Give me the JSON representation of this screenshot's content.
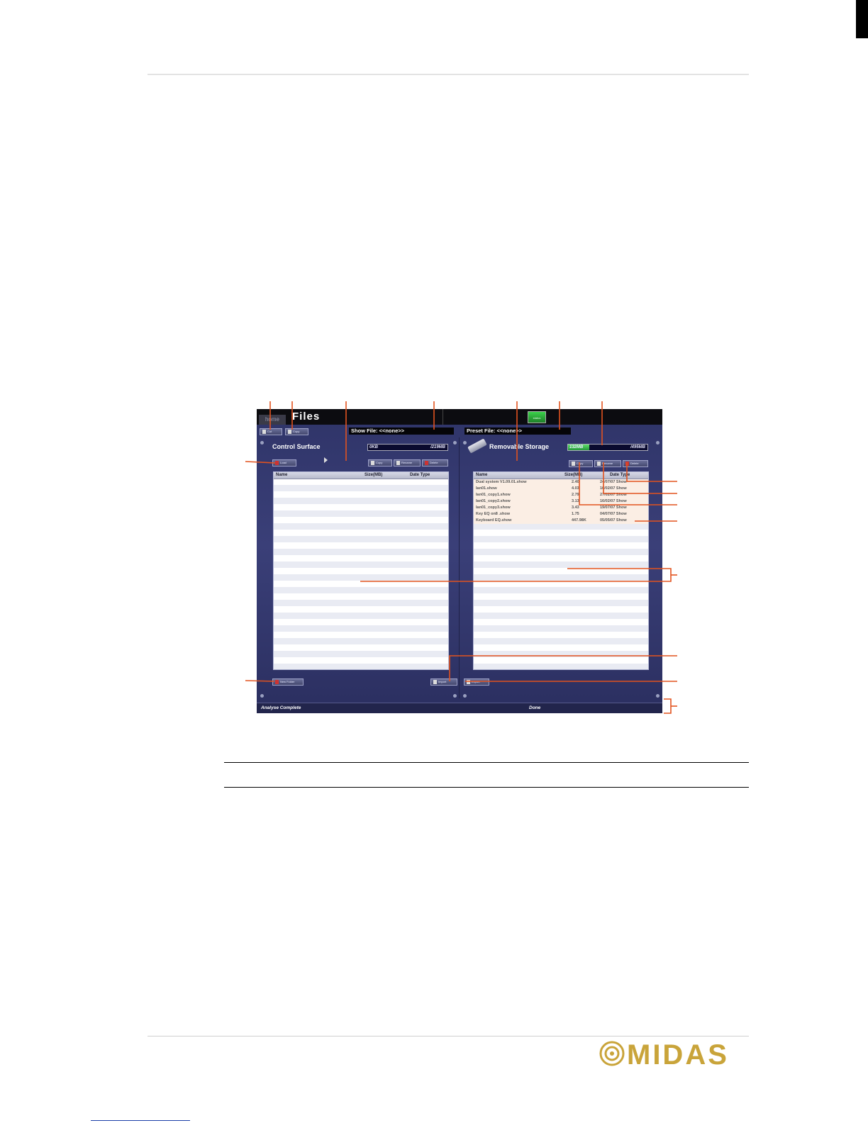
{
  "screen": {
    "home_tab": "home",
    "title": "Files",
    "status_button": "status",
    "show_file": "Show File: <<none>>",
    "preset_file": "Preset File: <<none>>",
    "toolbar": {
      "cut": "Cut",
      "copy": "Copy"
    },
    "control_surface": {
      "title": "Control Surface",
      "meter_used": "0KB",
      "meter_total": "/219MB",
      "load_button": "Load",
      "copy_button": "Copy",
      "rename_button": "Rename",
      "delete_button": "Delete",
      "columns": [
        "Name",
        "Size(MB)",
        "Date Type"
      ],
      "new_folder_button": "New Folder",
      "import_button": "Import"
    },
    "removable_storage": {
      "title": "Removable Storage",
      "meter_used": "132MB",
      "meter_total": "/495MB",
      "meter_fraction": 0.27,
      "copy_button": "Copy",
      "rename_button": "Rename",
      "delete_button": "Delete",
      "columns": [
        "Name",
        "Size(MB)",
        "Date Type"
      ],
      "files": [
        {
          "name": "Dual system V1.09.01.show",
          "size": "2.40",
          "date_type": "24/07/07 Show"
        },
        {
          "name": "Ian01.show",
          "size": "4.03",
          "date_type": "16/02/07 Show"
        },
        {
          "name": "Ian01_copy1.show",
          "size": "2.79",
          "date_type": "27/02/07 Show"
        },
        {
          "name": "Ian01_copy2.show",
          "size": "3.13",
          "date_type": "16/02/07 Show"
        },
        {
          "name": "Ian01_copy3.show",
          "size": "3.43",
          "date_type": "19/07/07 Show"
        },
        {
          "name": "Key EQ on8 .show",
          "size": "1.75",
          "date_type": "04/07/07 Show"
        },
        {
          "name": "Keyboard EQ.show",
          "size": "447.98K",
          "date_type": "05/05/07 Show"
        }
      ],
      "export_button": "Export"
    },
    "status_left": "Analyse Complete",
    "status_right": "Done"
  },
  "logo": {
    "text": "MIDAS",
    "color": "#c9a43a"
  },
  "colors": {
    "callout": "#e2531f"
  }
}
